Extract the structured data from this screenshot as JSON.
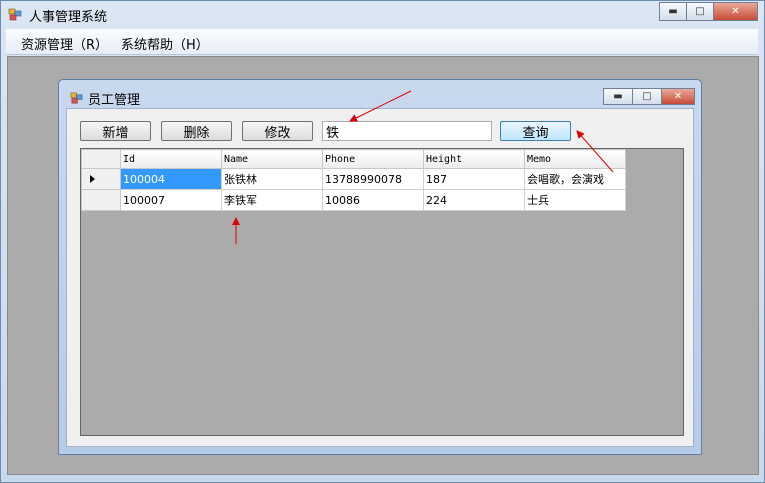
{
  "window": {
    "title": "人事管理系统",
    "controls": {
      "minimize": "▬",
      "maximize": "□",
      "close": "✕"
    }
  },
  "menu": {
    "items": [
      "资源管理（R）",
      "系统帮助（H）"
    ]
  },
  "child": {
    "title": "员工管理",
    "toolbar": {
      "add_label": "新增",
      "delete_label": "删除",
      "edit_label": "修改",
      "query_label": "查询"
    },
    "search": {
      "value": "铁"
    },
    "grid": {
      "columns": [
        "Id",
        "Name",
        "Phone",
        "Height",
        "Memo"
      ],
      "rows": [
        {
          "id": "100004",
          "name": "张铁林",
          "phone": "13788990078",
          "height": "187",
          "memo": "会唱歌，会演戏"
        },
        {
          "id": "100007",
          "name": "李铁军",
          "phone": "10086",
          "height": "224",
          "memo": "士兵"
        }
      ],
      "selected_row": 0
    }
  },
  "annotation_color": "#e00000"
}
